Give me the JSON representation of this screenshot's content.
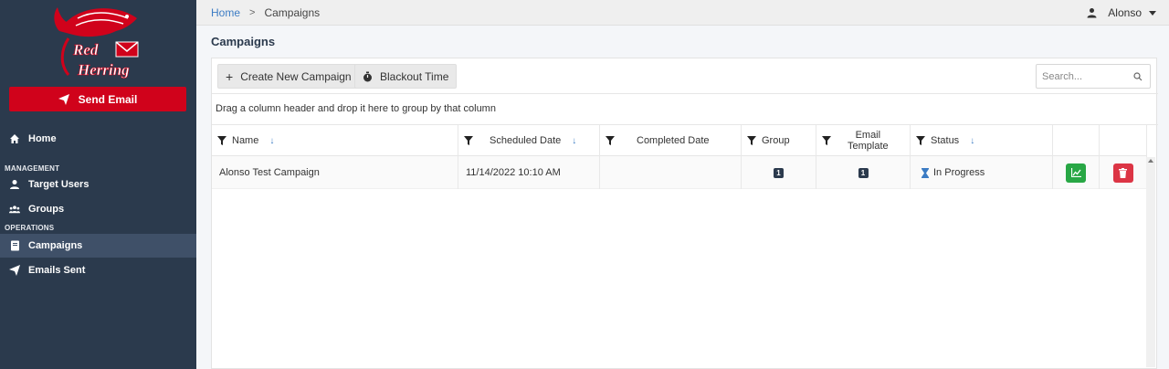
{
  "sidebar": {
    "brand_line1": "Red",
    "brand_line2": "Herring",
    "send_email_label": "Send Email",
    "home_label": "Home",
    "section_management": "MANAGEMENT",
    "target_users_label": "Target Users",
    "groups_label": "Groups",
    "section_operations": "OPERATIONS",
    "campaigns_label": "Campaigns",
    "emails_sent_label": "Emails Sent"
  },
  "topbar": {
    "breadcrumb_home": "Home",
    "breadcrumb_separator": ">",
    "breadcrumb_current": "Campaigns",
    "user_name": "Alonso"
  },
  "page": {
    "title": "Campaigns"
  },
  "toolbar": {
    "create_label": "Create New Campaign",
    "blackout_label": "Blackout Time",
    "search_placeholder": "Search..."
  },
  "grid": {
    "group_hint": "Drag a column header and drop it here to group by that column",
    "columns": {
      "name": "Name",
      "scheduled": "Scheduled Date",
      "completed": "Completed Date",
      "group": "Group",
      "email_template_line1": "Email",
      "email_template_line2": "Template",
      "status": "Status"
    },
    "rows": [
      {
        "name": "Alonso Test Campaign",
        "scheduled": "11/14/2022 10:10 AM",
        "completed": "",
        "group_count": "1",
        "template_count": "1",
        "status": "In Progress"
      }
    ]
  },
  "colors": {
    "sidebar_bg": "#2b3a4d",
    "accent_red": "#d0021b",
    "success_green": "#28a745",
    "danger_red": "#dc3545",
    "link_blue": "#3c7cc4"
  }
}
